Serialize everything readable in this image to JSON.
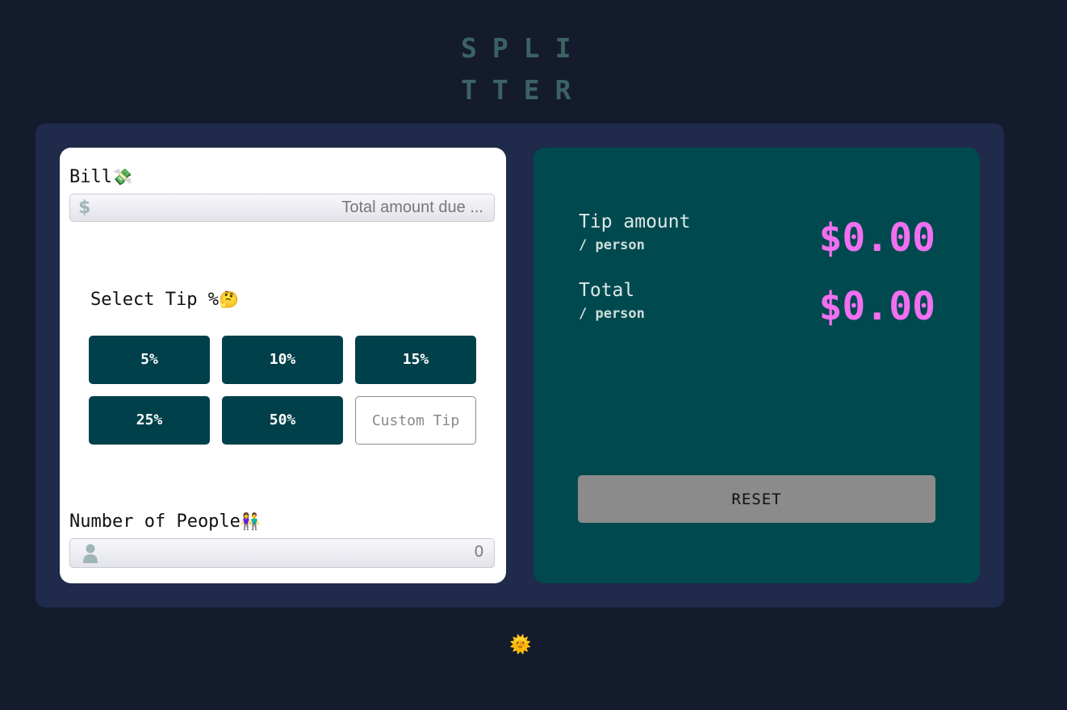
{
  "app": {
    "logo_line1": "SPLI",
    "logo_line2": "TTER",
    "theme_toggle_icon": "🌞"
  },
  "bill": {
    "label": "Bill",
    "label_emoji": "💸",
    "currency_icon": "$",
    "placeholder": "Total amount due ...",
    "value": ""
  },
  "tip": {
    "label": "Select Tip %",
    "label_emoji": "🤔",
    "options": [
      "5%",
      "10%",
      "15%",
      "25%",
      "50%"
    ],
    "custom_placeholder": "Custom Tip"
  },
  "people": {
    "label": "Number of People",
    "label_emoji": "👫",
    "icon": "person-icon",
    "placeholder": "0",
    "value": ""
  },
  "results": {
    "tip_label": "Tip amount",
    "tip_sub": "/ person",
    "tip_value": "$0.00",
    "total_label": "Total",
    "total_sub": "/ person",
    "total_value": "$0.00",
    "reset_label": "RESET"
  },
  "colors": {
    "background": "#141b2c",
    "card": "#202a4a",
    "accent": "#00404a",
    "result_panel": "#004a4f",
    "amount": "#f16ff0",
    "reset": "#8b8b8b"
  }
}
